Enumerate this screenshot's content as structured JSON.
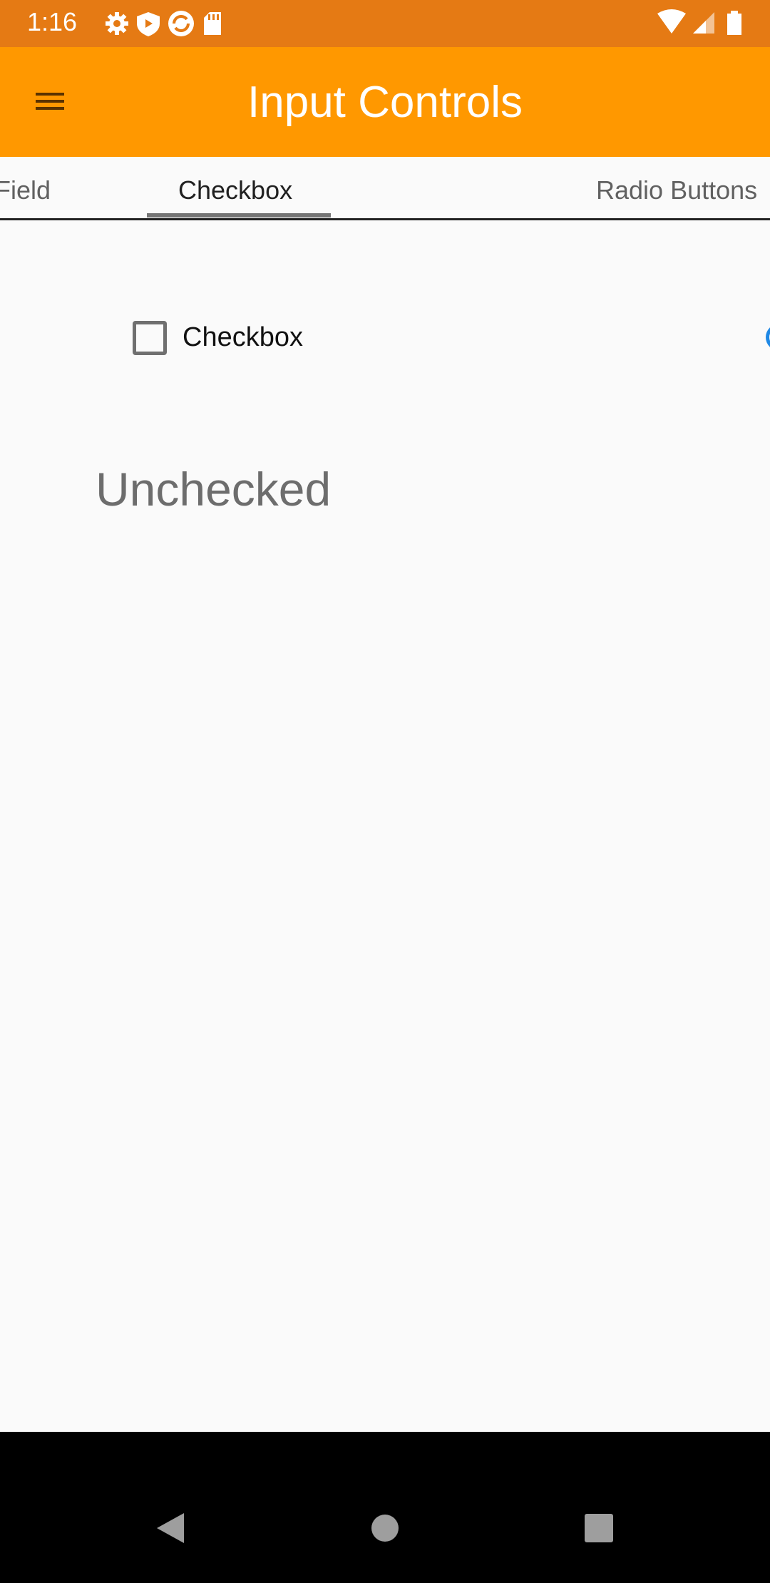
{
  "status_bar": {
    "time": "1:16",
    "left_icons": [
      "settings-icon",
      "shield-icon",
      "sync-icon",
      "sd-card-icon"
    ],
    "right_icons": [
      "wifi-icon",
      "signal-icon",
      "battery-icon"
    ]
  },
  "app_bar": {
    "title": "Input Controls",
    "menu_icon": "hamburger-menu-icon",
    "color": "#ff9800"
  },
  "tabs": [
    {
      "label": "Field",
      "selected": false
    },
    {
      "label": "Checkbox",
      "selected": true
    },
    {
      "label": "Radio Buttons",
      "selected": false
    }
  ],
  "content": {
    "checkbox": {
      "label": "Checkbox",
      "checked": false
    },
    "state_text": "Unchecked"
  },
  "nav_bar": {
    "buttons": [
      "back-icon",
      "home-icon",
      "recents-icon"
    ]
  }
}
